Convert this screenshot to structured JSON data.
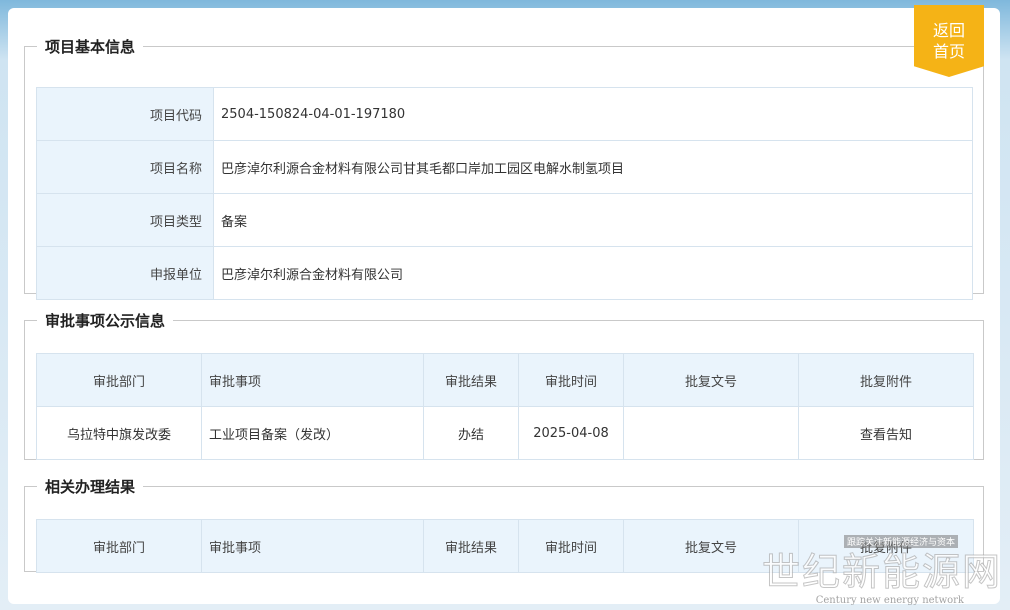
{
  "home_button": {
    "line1": "返回",
    "line2": "首页"
  },
  "basic_info": {
    "title": "项目基本信息",
    "rows": [
      {
        "label": "项目代码",
        "value": "2504-150824-04-01-197180"
      },
      {
        "label": "项目名称",
        "value": "巴彦淖尔利源合金材料有限公司甘其毛都口岸加工园区电解水制氢项目"
      },
      {
        "label": "项目类型",
        "value": "备案"
      },
      {
        "label": "申报单位",
        "value": "巴彦淖尔利源合金材料有限公司"
      }
    ]
  },
  "approval": {
    "title": "审批事项公示信息",
    "headers": [
      "审批部门",
      "审批事项",
      "审批结果",
      "审批时间",
      "批复文号",
      "批复附件"
    ],
    "rows": [
      {
        "dept": "乌拉特中旗发改委",
        "item": "工业项目备案（发改）",
        "result": "办结",
        "date": "2025-04-08",
        "doc_no": "",
        "attachment": "查看告知"
      }
    ]
  },
  "related": {
    "title": "相关办理结果",
    "headers": [
      "审批部门",
      "审批事项",
      "审批结果",
      "审批时间",
      "批复文号",
      "批复附件"
    ]
  },
  "watermark": {
    "cn": "世纪新能源网",
    "en": "Century new energy network",
    "tag": "跟踪关注新能源经济与资本"
  },
  "colors": {
    "accent": "#f5b316",
    "header_bg": "#eaf4fc",
    "border": "#d6e3ee"
  }
}
